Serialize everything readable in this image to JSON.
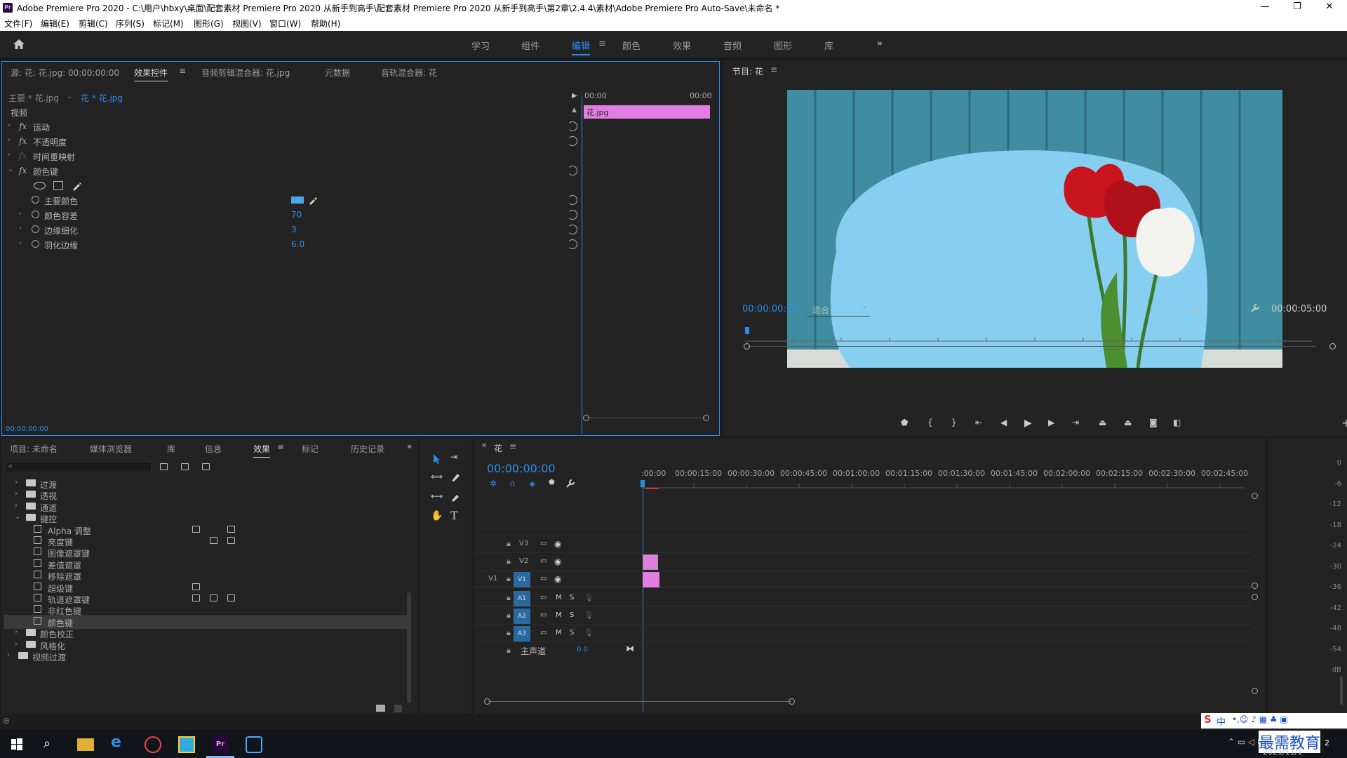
{
  "window": {
    "title": "Adobe Premiere Pro 2020 - C:\\用户\\hbxy\\桌面\\配套素材 Premiere Pro 2020 从新手到高手\\配套素材 Premiere Pro 2020 从新手到高手\\第2章\\2.4.4\\素材\\Adobe Premiere Pro Auto-Save\\未命名 *",
    "minimize": "—",
    "maximize": "❐",
    "close": "✕",
    "logo": "Pr"
  },
  "menu": [
    "文件(F)",
    "编辑(E)",
    "剪辑(C)",
    "序列(S)",
    "标记(M)",
    "图形(G)",
    "视图(V)",
    "窗口(W)",
    "帮助(H)"
  ],
  "workspaces": {
    "items": [
      "学习",
      "组件",
      "编辑",
      "颜色",
      "效果",
      "音频",
      "图形",
      "库"
    ],
    "active": "编辑",
    "more": "»",
    "menu": "≡"
  },
  "effect_controls": {
    "tabs": [
      "源: 花: 花.jpg: 00:00:00:00",
      "效果控件",
      "音频剪辑混合器: 花.jpg",
      "元数据",
      "音轨混合器: 花"
    ],
    "active_tab": "效果控件",
    "master": "主要 * 花.jpg",
    "clip": "花 * 花.jpg",
    "section": "视频",
    "time_start": "00:00",
    "time_end": "00:00",
    "clip_bar": "花.jpg",
    "effects": [
      {
        "name": "运动"
      },
      {
        "name": "不透明度"
      },
      {
        "name": "时间重映射"
      },
      {
        "name": "颜色键"
      }
    ],
    "params": [
      {
        "name": "主要颜色",
        "value": ""
      },
      {
        "name": "颜色容差",
        "value": "70"
      },
      {
        "name": "边缘细化",
        "value": "3"
      },
      {
        "name": "羽化边缘",
        "value": "6.0"
      }
    ],
    "key_color": "#4aa8f0",
    "timecode": "00:00:00:00"
  },
  "program": {
    "title": "节目: 花",
    "timecode": "00:00:00:00",
    "fit": "适合",
    "resolution": "1/2",
    "duration": "00:00:05:00",
    "sky_color": "#87cff0",
    "wood_color": "#3f8da0"
  },
  "project": {
    "tabs": [
      "项目: 未命名",
      "媒体浏览器",
      "库",
      "信息",
      "效果",
      "标记",
      "历史记录"
    ],
    "active_tab": "效果",
    "tree": [
      {
        "label": "过渡",
        "indent": 1,
        "type": "folder",
        "open": false
      },
      {
        "label": "透视",
        "indent": 1,
        "type": "folder",
        "open": false
      },
      {
        "label": "通道",
        "indent": 1,
        "type": "folder",
        "open": false
      },
      {
        "label": "键控",
        "indent": 1,
        "type": "folder",
        "open": true
      },
      {
        "label": "Alpha 调整",
        "indent": 2,
        "type": "fx",
        "badges": [
          1,
          3
        ]
      },
      {
        "label": "亮度键",
        "indent": 2,
        "type": "fx",
        "badges": [
          2,
          3
        ]
      },
      {
        "label": "图像遮罩键",
        "indent": 2,
        "type": "fx",
        "badges": []
      },
      {
        "label": "差值遮罩",
        "indent": 2,
        "type": "fx",
        "badges": []
      },
      {
        "label": "移除遮罩",
        "indent": 2,
        "type": "fx",
        "badges": []
      },
      {
        "label": "超级键",
        "indent": 2,
        "type": "fx",
        "badges": [
          1
        ]
      },
      {
        "label": "轨道遮罩键",
        "indent": 2,
        "type": "fx",
        "badges": [
          1,
          2,
          3
        ]
      },
      {
        "label": "非红色键",
        "indent": 2,
        "type": "fx",
        "badges": []
      },
      {
        "label": "颜色键",
        "indent": 2,
        "type": "fx",
        "badges": [],
        "selected": true
      },
      {
        "label": "颜色校正",
        "indent": 1,
        "type": "folder",
        "open": false
      },
      {
        "label": "风格化",
        "indent": 1,
        "type": "folder",
        "open": false
      },
      {
        "label": "视频过渡",
        "indent": 0,
        "type": "folder",
        "open": false
      }
    ]
  },
  "timeline": {
    "name": "花",
    "timecode": "00:00:00:00",
    "ruler": [
      ":00:00",
      "00:00:15:00",
      "00:00:30:00",
      "00:00:45:00",
      "00:01:00:00",
      "00:01:15:00",
      "00:01:30:00",
      "00:01:45:00",
      "00:02:00:00",
      "00:02:15:00",
      "00:02:30:00",
      "00:02:45:00"
    ],
    "video_tracks": [
      "V3",
      "V2",
      "V1"
    ],
    "audio_tracks": [
      "A1",
      "A2",
      "A3"
    ],
    "source_patch": "V1",
    "master_label": "主声道",
    "master_value": "0.0",
    "m_label": "M",
    "s_label": "S",
    "clip_color": "#e27de2"
  },
  "meter": {
    "labels": [
      "0",
      "-6",
      "-12",
      "-18",
      "-24",
      "-30",
      "-36",
      "-42",
      "-48",
      "-54",
      "dB"
    ]
  },
  "taskbar": {
    "ime": "中",
    "date": "2021/11/1",
    "brand": "最需教育",
    "notify": "2"
  }
}
